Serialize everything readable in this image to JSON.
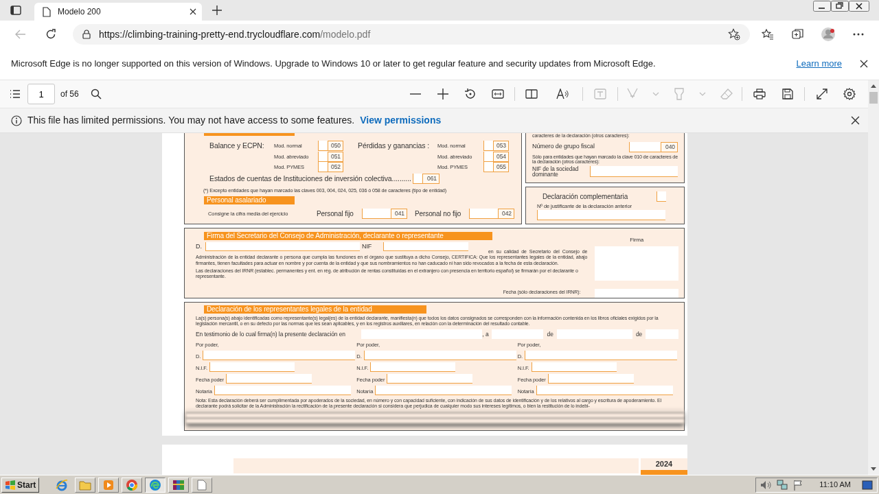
{
  "browser": {
    "tab": {
      "title": "Modelo 200"
    },
    "address": {
      "host": "https://climbing-training-pretty-end.trycloudflare.com",
      "path": "/modelo.pdf"
    },
    "notice": {
      "text": "Microsoft Edge is no longer supported on this version of Windows. Upgrade to Windows 10 or later to get regular feature and security updates from Microsoft Edge.",
      "link": "Learn more"
    },
    "pdf_toolbar": {
      "page": "1",
      "page_count": "of 56"
    },
    "permissions_bar": {
      "text": "This file has limited permissions. You may not have access to some features.",
      "link": "View permissions"
    }
  },
  "document": {
    "estados": {
      "groups": [
        {
          "label": "Balance y ECPN:",
          "options": [
            {
              "label": "Mod. normal",
              "code": "050",
              "checked": false
            },
            {
              "label": "Mod. abreviado",
              "code": "051",
              "checked": false
            },
            {
              "label": "Mod. PYMES",
              "code": "052",
              "checked": false
            }
          ]
        },
        {
          "label": "Pérdidas y ganancias :",
          "options": [
            {
              "label": "Mod. normal",
              "code": "053",
              "checked": false
            },
            {
              "label": "Mod. abreviado",
              "code": "054",
              "checked": false
            },
            {
              "label": "Mod. PYMES",
              "code": "055",
              "checked": false
            }
          ]
        }
      ],
      "collective": {
        "label": "Estados de cuentas de Instituciones de inversión colectiva..........",
        "code": "061",
        "checked": false
      },
      "footnote": "(*) Excepto entidades que hayan marcado las claves 003, 004, 024, 025, 036 ó 058 de caracteres (tipo de entidad)"
    },
    "personal": {
      "title": "Personal asalariado",
      "hint": "Consigne la  cifra media del ejercicio",
      "fields": [
        {
          "label": "Personal fijo",
          "code": "041"
        },
        {
          "label": "Personal no fijo",
          "code": "042"
        }
      ]
    },
    "grupo": {
      "top_text": "caracteres de la declaración (otros caracteres):",
      "label": "Número de grupo fiscal",
      "code": "040",
      "note": "Sólo para entidades que hayan marcado la clave 010 de caracteres de la declaración (otros caracteres):",
      "nif_label": "NIF de la sociedad dominante"
    },
    "complementaria": {
      "label": "Declaración complementaria",
      "checked": false,
      "prev_label": "Nº de justificante de la declaración anterior"
    },
    "firma": {
      "title": "Firma del Secretario del Consejo de Administración, declarante o representante",
      "d_label": "D.",
      "nif_label": "NIF",
      "firma_label": "Firma",
      "para1": "en su calidad de Secretario del Consejo de Administración de la entidad declarante o persona que cumpla las funciones en el órgano que sustituya a dicho Consejo, CERTIFICA: Que los representantes legales de la entidad, abajo firmantes, tienen facultades para actuar en nombre y por cuenta de la entidad y que sus nombramientos no han caducado ni han sido revocados a la fecha de esta declaración.",
      "para2": "Las declaraciones del IRNR (establec. permanentes y ent. en rég. de atribución de rentas constituidas en el extranjero con presencia en territorio español) se firmarán por el declarante o representante.",
      "fecha_label": "Fecha (sólo declaraciones del IRNR):"
    },
    "representantes": {
      "title": "Declaración de los representantes legales de la entidad",
      "intro": "La(s) persona(s) abajo identificadas como representante(s) legal(es) de la entidad declarante, manifiesta(n) que todos los datos consignados se corresponden con la información contenida en los libros oficiales exigidos por la legislación mercantil, o en su defecto por las normas que les sean aplicables, y en los registros auxiliares, en relación con la determinación del resultado contable.",
      "testimonio": {
        "label": "En testimonio de lo cual firma(n) la presente declaración en",
        "a": ", a",
        "de_1": "de",
        "de_2": "de"
      },
      "columns": [
        {
          "por_poder": "Por poder,",
          "d": "D.",
          "nif": "N.I.F.",
          "fecha": "Fecha poder",
          "notaria": "Notaría"
        },
        {
          "por_poder": "Por poder,",
          "d": "D.",
          "nif": "N.I.F.",
          "fecha": "Fecha poder",
          "notaria": "Notaría"
        },
        {
          "por_poder": "Por poder,",
          "d": "D.",
          "nif": "N.I.F.",
          "fecha": "Fecha poder",
          "notaria": "Notaría"
        }
      ],
      "note": "Nota: Esta declaración deberá ser cumplimentada por apoderados de la sociedad, en número y con capacidad suficiente, con indicación de sus datos de identificación y de los relativos al cargo y escritura de apoderamiento. El declarante podrá solicitar de la Administración la rectificación de la presente declaración si considera que perjudica de cualquier modo sus intereses legítimos, o bien la restitución de lo indebi-"
    },
    "page_2": {
      "year": "2024"
    }
  },
  "taskbar": {
    "start": "Start",
    "clock": "11:10 AM"
  }
}
